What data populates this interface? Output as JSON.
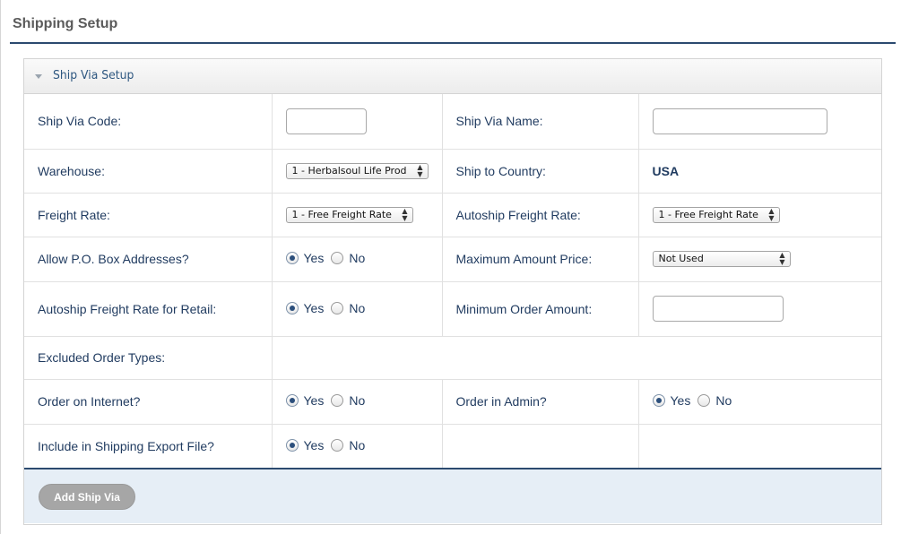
{
  "page": {
    "title": "Shipping Setup"
  },
  "panel": {
    "title": "Ship Via Setup"
  },
  "form": {
    "ship_via_code": {
      "label": "Ship Via Code:",
      "value": ""
    },
    "ship_via_name": {
      "label": "Ship Via Name:",
      "value": ""
    },
    "warehouse": {
      "label": "Warehouse:",
      "selected": "1 - Herbalsoul Life Prod"
    },
    "ship_to_country": {
      "label": "Ship to Country:",
      "value": "USA"
    },
    "freight_rate": {
      "label": "Freight Rate:",
      "selected": "1 - Free Freight Rate"
    },
    "autoship_freight_rate": {
      "label": "Autoship Freight Rate:",
      "selected": "1 - Free Freight Rate"
    },
    "allow_po_box": {
      "label": "Allow P.O. Box Addresses?",
      "yes": "Yes",
      "no": "No",
      "selected": "Yes"
    },
    "maximum_amount_price": {
      "label": "Maximum Amount Price:",
      "selected": "Not Used"
    },
    "autoship_freight_retail": {
      "label": "Autoship Freight Rate for Retail:",
      "yes": "Yes",
      "no": "No",
      "selected": "Yes"
    },
    "minimum_order_amount": {
      "label": "Minimum Order Amount:",
      "value": ""
    },
    "excluded_order_types": {
      "label": "Excluded Order Types:"
    },
    "order_on_internet": {
      "label": "Order on Internet?",
      "yes": "Yes",
      "no": "No",
      "selected": "Yes"
    },
    "order_in_admin": {
      "label": "Order in Admin?",
      "yes": "Yes",
      "no": "No",
      "selected": "Yes"
    },
    "include_in_export": {
      "label": "Include in Shipping Export File?",
      "yes": "Yes",
      "no": "No",
      "selected": "Yes"
    }
  },
  "footer": {
    "add_button_label": "Add Ship Via"
  },
  "colors": {
    "accent": "#2b4a6f",
    "label_text": "#1f3a5f",
    "footer_bg": "#e6eef6",
    "button_bg": "#a6a6a6"
  },
  "icons": {
    "panel_toggle": "caret-down-icon",
    "select_arrows": "updown-arrows-icon"
  }
}
